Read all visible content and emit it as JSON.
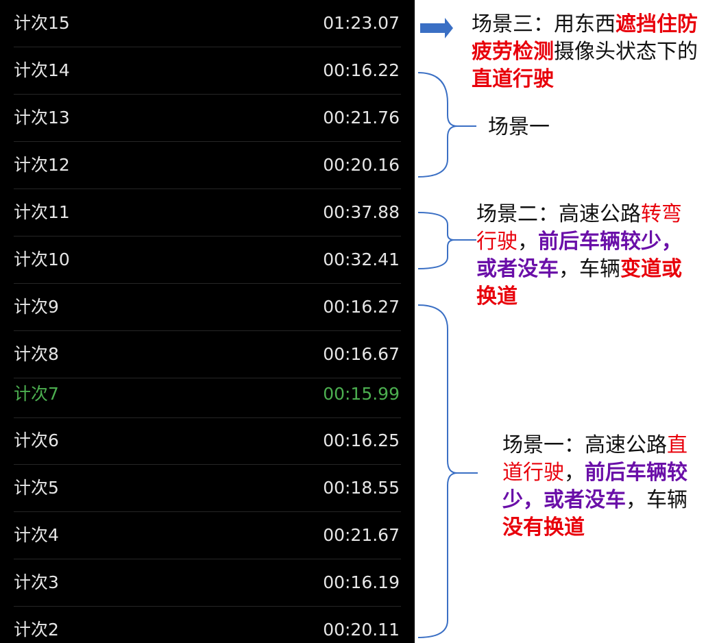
{
  "laps": [
    {
      "label": "计次15",
      "time": "01:23.07"
    },
    {
      "label": "计次14",
      "time": "00:16.22"
    },
    {
      "label": "计次13",
      "time": "00:21.76"
    },
    {
      "label": "计次12",
      "time": "00:20.16"
    },
    {
      "label": "计次11",
      "time": "00:37.88"
    },
    {
      "label": "计次10",
      "time": "00:32.41"
    },
    {
      "label": "计次9",
      "time": "00:16.27"
    },
    {
      "label": "计次8",
      "time": "00:16.67"
    },
    {
      "label": "计次7",
      "time": "00:15.99"
    },
    {
      "label": "计次6",
      "time": "00:16.25"
    },
    {
      "label": "计次5",
      "time": "00:18.55"
    },
    {
      "label": "计次4",
      "time": "00:21.67"
    },
    {
      "label": "计次3",
      "time": "00:16.19"
    },
    {
      "label": "计次2",
      "time": "00:20.11"
    }
  ],
  "colors": {
    "background": "#000000",
    "text": "#e6e6e6",
    "best_lap": "#4caf50",
    "highlight_red": "#e8000b",
    "highlight_purple": "#6a0fa8",
    "bracket": "#3a6fc4"
  },
  "notes": {
    "scene3": {
      "prefix": "场景三：用东西",
      "red1": "遮挡住防疲劳检测",
      "mid": "摄像头状态下的",
      "red2": "直道行驶"
    },
    "scene1_short": {
      "text": "场景一"
    },
    "scene2": {
      "prefix": "场景二：高速公路",
      "red1": "转弯行驶",
      "comma1": "，",
      "purple1": "前后车辆较少，或者没车",
      "comma2": "，车辆",
      "red2": "变道或换道"
    },
    "scene1": {
      "prefix": "场景一：高速公路",
      "red1": "直道行驶",
      "comma1": "，",
      "purple1": "前后车辆较少，或者没车",
      "comma2": "，车辆",
      "red2": "没有换道"
    }
  }
}
